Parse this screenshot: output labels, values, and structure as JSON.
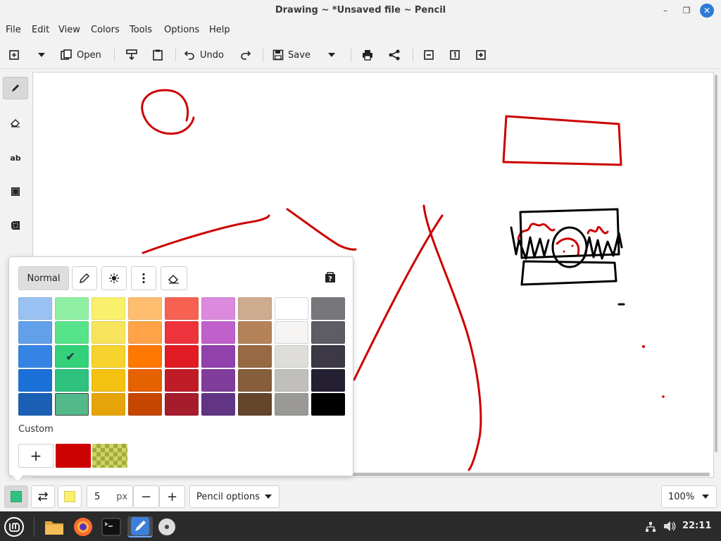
{
  "window": {
    "title": "Drawing ~ *Unsaved file ~ Pencil",
    "minimize_glyph": "–",
    "maximize_glyph": "❐",
    "close_glyph": "✕"
  },
  "menu": [
    "File",
    "Edit",
    "View",
    "Colors",
    "Tools",
    "Options",
    "Help"
  ],
  "toolbar": {
    "open_label": "Open",
    "undo_label": "Undo",
    "save_label": "Save"
  },
  "sidebar": {
    "text_tool_label": "ab"
  },
  "color_popover": {
    "mode_label": "Normal",
    "custom_label": "Custom",
    "add_glyph": "+",
    "palette": [
      [
        "#99c1f1",
        "#8ff0a4",
        "#f9f06b",
        "#ffbe6f",
        "#f66151",
        "#dc8add",
        "#cdab8f",
        "#ffffff",
        "#77767b"
      ],
      [
        "#62a0ea",
        "#57e389",
        "#f8e45c",
        "#ffa348",
        "#ed333b",
        "#c061cb",
        "#b5835a",
        "#f6f5f4",
        "#5e5c64"
      ],
      [
        "#3584e4",
        "#33d17a",
        "#f6d32d",
        "#ff7800",
        "#e01b24",
        "#9141ac",
        "#986a44",
        "#deddda",
        "#3d3846"
      ],
      [
        "#1c71d8",
        "#2ec27e",
        "#f5c211",
        "#e66100",
        "#c01c28",
        "#813d9c",
        "#865e3c",
        "#c0bfbc",
        "#241f31"
      ],
      [
        "#1a5fb4",
        "#53b88a",
        "#e5a50a",
        "#c64600",
        "#a51d2d",
        "#613583",
        "#63452c",
        "#9a9996",
        "#000000"
      ]
    ],
    "selected_color": "#2ec27e",
    "custom_colors": [
      "#cc0000",
      "checkered-yellow"
    ]
  },
  "bottombar": {
    "main_color": "#2ec27e",
    "secondary_color": "#f9f06b",
    "size_value": "5",
    "size_unit": "px",
    "minus_glyph": "−",
    "plus_glyph": "+",
    "options_label": "Pencil options",
    "zoom_label": "100%"
  },
  "taskbar": {
    "clock": "22:11"
  },
  "colors": {
    "accent": "#2e7bd6",
    "stroke_red": "#cc0000",
    "stroke_black": "#000000"
  }
}
